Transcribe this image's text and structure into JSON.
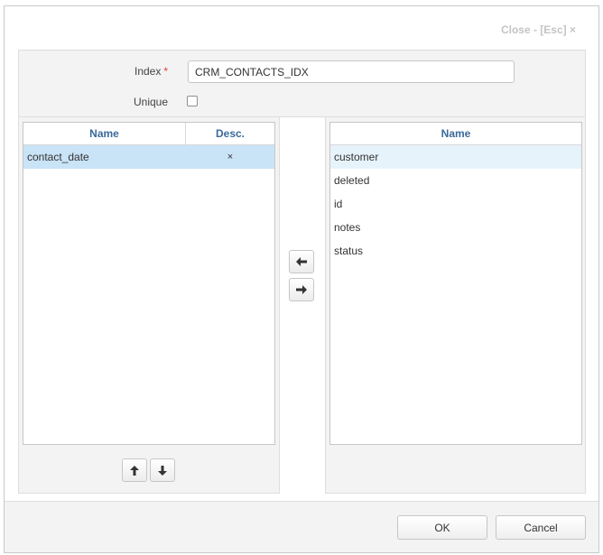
{
  "dialog": {
    "close_label": "Close - [Esc] ×"
  },
  "form": {
    "index_label": "Index",
    "required_mark": "*",
    "index_value": "CRM_CONTACTS_IDX",
    "unique_label": "Unique",
    "unique_checked": false
  },
  "index_columns": {
    "headers": {
      "name": "Name",
      "desc": "Desc."
    },
    "rows": [
      {
        "name": "contact_date",
        "desc": "×",
        "selected": true
      }
    ]
  },
  "available_columns": {
    "header": "Name",
    "rows": [
      "customer",
      "deleted",
      "id",
      "notes",
      "status"
    ]
  },
  "icons": {
    "move_up": "arrow-up-icon",
    "move_down": "arrow-down-icon",
    "add_left": "arrow-left-icon",
    "remove_right": "arrow-right-icon"
  },
  "footer": {
    "ok_label": "OK",
    "cancel_label": "Cancel"
  }
}
